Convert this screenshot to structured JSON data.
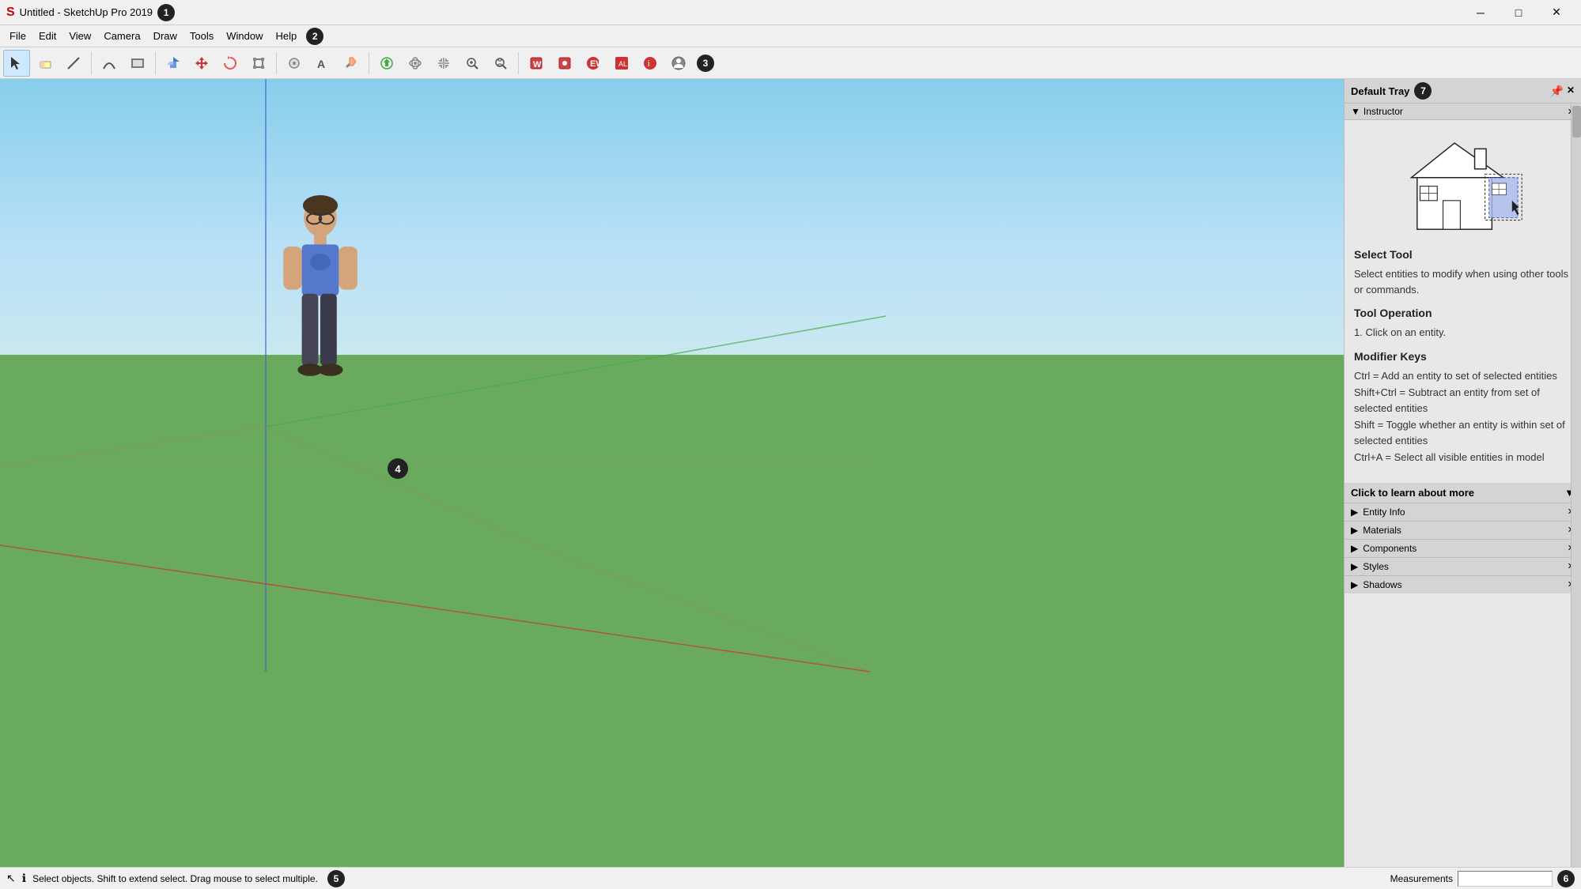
{
  "app": {
    "title": "Untitled - SketchUp Pro 2019",
    "badge": "1"
  },
  "titlebar": {
    "minimize_label": "─",
    "maximize_label": "□",
    "close_label": "✕"
  },
  "menubar": {
    "badge": "2",
    "items": [
      "File",
      "Edit",
      "View",
      "Camera",
      "Draw",
      "Tools",
      "Window",
      "Help"
    ]
  },
  "toolbar": {
    "badge": "3"
  },
  "viewport": {
    "badge": "4",
    "badge_label": "4"
  },
  "statusbar": {
    "badge": "5",
    "info_icon": "ℹ",
    "select_icon": "↖",
    "message": "Select objects. Shift to extend select. Drag mouse to select multiple.",
    "measurements_label": "Measurements",
    "badge_right": "6"
  },
  "right_panel": {
    "default_tray_label": "Default Tray",
    "tray_badge": "7",
    "instructor_label": "Instructor",
    "select_tool_title": "Select Tool",
    "select_tool_desc": "Select entities to modify when using other tools or commands.",
    "tool_operation_title": "Tool Operation",
    "tool_operation_step": "1. Click on an entity.",
    "modifier_keys_title": "Modifier Keys",
    "modifier_keys_items": [
      "Ctrl = Add an entity to set of selected entities",
      "Shift+Ctrl = Subtract an entity from set of selected entities",
      "Shift = Toggle whether an entity is within set of selected entities",
      "Ctrl+A = Select all visible entities in model"
    ],
    "click_to_learn": "Click to learn about more",
    "sections": [
      {
        "label": "Entity Info"
      },
      {
        "label": "Materials"
      },
      {
        "label": "Components"
      },
      {
        "label": "Styles"
      },
      {
        "label": "Shadows"
      }
    ]
  }
}
